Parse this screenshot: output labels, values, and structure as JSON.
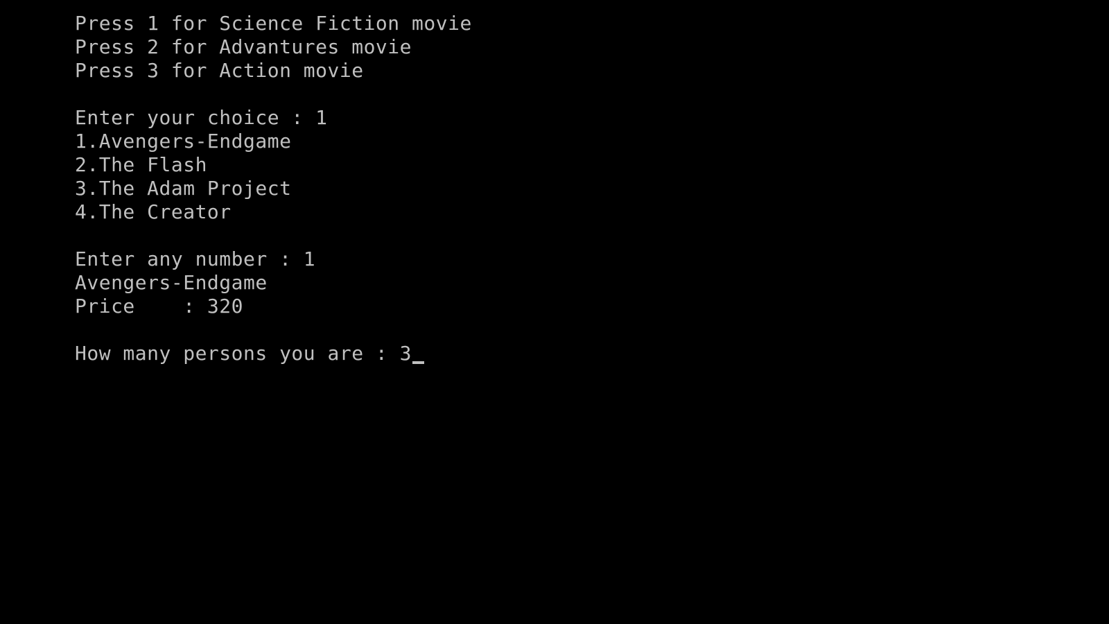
{
  "console": {
    "menu": [
      "Press 1 for Science Fiction movie",
      "Press 2 for Advantures movie",
      "Press 3 for Action movie"
    ],
    "choice_prompt": "Enter your choice : 1",
    "movies": [
      "1.Avengers-Endgame",
      "2.The Flash",
      "3.The Adam Project",
      "4.The Creator"
    ],
    "number_prompt": "Enter any number : 1",
    "selected_movie": "Avengers-Endgame",
    "price_line": "Price    : 320",
    "persons_prompt": "How many persons you are : 3",
    "colors": {
      "background": "#000000",
      "text": "#c0c0c0"
    }
  }
}
